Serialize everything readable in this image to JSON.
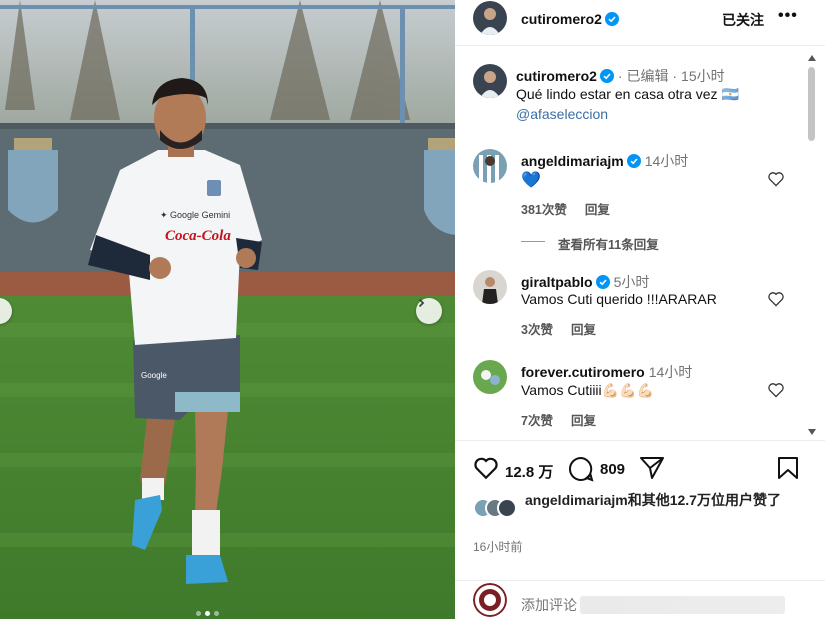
{
  "post": {
    "author": "cutiromero2",
    "follow_label": "已关注",
    "more_label": "•••",
    "caption": {
      "author": "cutiromero2",
      "edited_label": "· 已编辑 ·",
      "time": "15小时",
      "text": "Qué lindo estar en casa otra vez 🇦🇷",
      "mention": "@afaseleccion"
    },
    "photo": {
      "jersey_text_1": "Google Gemini",
      "jersey_text_2": "Coca-Cola",
      "shorts_text": "Google",
      "active_dot": 1,
      "dot_count": 3
    }
  },
  "comments": [
    {
      "username": "angeldimariajm",
      "time": "14小时",
      "text": "💙",
      "likes": "381次赞",
      "reply": "回复",
      "view_replies": "查看所有11条回复"
    },
    {
      "username": "giraltpablo",
      "time": "5小时",
      "text": "Vamos Cuti querido !!!ARARAR",
      "likes": "3次赞",
      "reply": "回复"
    },
    {
      "username": "forever.cutiromero",
      "time": "14小时",
      "text": "Vamos Cutiiii💪🏻💪🏻💪🏻",
      "likes": "7次赞",
      "reply": "回复"
    }
  ],
  "actions": {
    "likes_count": "12.8 万",
    "comments_count": "809"
  },
  "liked_by_text": "angeldimariajm和其他12.7万位用户赞了",
  "time_ago": "16小时前",
  "add_comment_placeholder": "添加评论",
  "colors": {
    "verified": "#0095f6",
    "mention": "#3a6ea5",
    "heart_blue": "#1877f2",
    "pitch": "#5c8f3c",
    "jersey": "#f3f5f7",
    "shorts": "#4a5868"
  }
}
